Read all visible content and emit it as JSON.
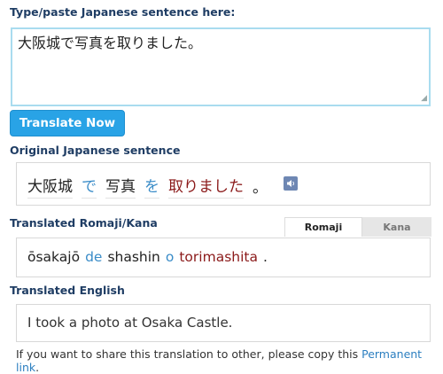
{
  "input": {
    "label": "Type/paste Japanese sentence here:",
    "value": "大阪城で写真を取りました。",
    "resize_glyph": "⁄"
  },
  "translate_button": {
    "label": "Translate Now"
  },
  "original": {
    "label": "Original Japanese sentence",
    "tokens": [
      {
        "text": "大阪城",
        "kind": "noun"
      },
      {
        "text": "で",
        "kind": "particle"
      },
      {
        "text": "写真",
        "kind": "noun"
      },
      {
        "text": "を",
        "kind": "particle"
      },
      {
        "text": "取りました",
        "kind": "verb"
      },
      {
        "text": "。",
        "kind": "punct"
      }
    ],
    "speaker_icon": "speaker-icon"
  },
  "romaji": {
    "label": "Translated Romaji/Kana",
    "tabs": [
      "Romaji",
      "Kana"
    ],
    "active_tab": "Romaji",
    "tokens": [
      {
        "text": "ōsakajō",
        "kind": "noun"
      },
      {
        "text": "de",
        "kind": "particle"
      },
      {
        "text": "shashin",
        "kind": "noun"
      },
      {
        "text": "o",
        "kind": "particle"
      },
      {
        "text": "torimashita",
        "kind": "verb"
      },
      {
        "text": ".",
        "kind": "punct"
      }
    ]
  },
  "english": {
    "label": "Translated English",
    "value": "I took a photo at Osaka Castle."
  },
  "footer": {
    "text": "If you want to share this translation to other, please copy this ",
    "link": "Permanent link",
    "suffix": "."
  },
  "colors": {
    "accent": "#29a3e6",
    "label": "#1f3d64",
    "particle": "#3a8cc8",
    "verb": "#8b1a1a",
    "link": "#2c7fc0"
  }
}
